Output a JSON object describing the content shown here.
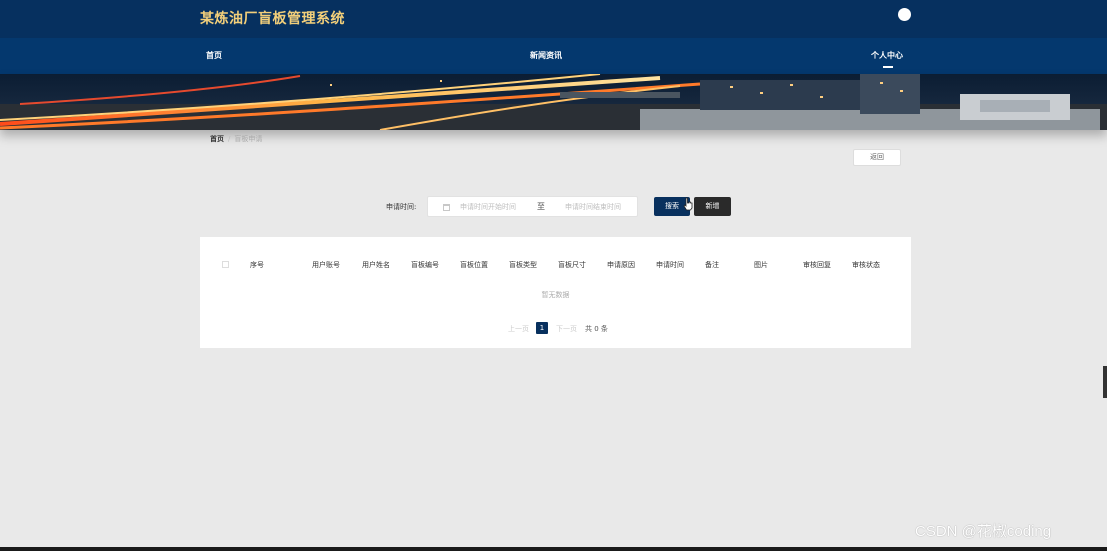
{
  "header": {
    "site_title": "某炼油厂盲板管理系统"
  },
  "nav": {
    "items": [
      "首页",
      "新闻资讯",
      "个人中心"
    ],
    "active": "个人中心"
  },
  "breadcrumb": {
    "home": "首页",
    "separator": "/",
    "current": "盲板申请"
  },
  "actions": {
    "back_label": "返回"
  },
  "filter": {
    "label": "申请时间:",
    "start_placeholder": "申请时间开始时间",
    "range_separator": "至",
    "end_placeholder": "申请时间结束时间",
    "search_label": "搜索",
    "add_label": "新增"
  },
  "table": {
    "columns": [
      "序号",
      "用户账号",
      "用户姓名",
      "盲板编号",
      "盲板位置",
      "盲板类型",
      "盲板尺寸",
      "申请原因",
      "申请时间",
      "备注",
      "图片",
      "审核回复",
      "审核状态"
    ],
    "empty_text": "暂无数据"
  },
  "pagination": {
    "prev_label": "上一页",
    "current_page": "1",
    "next_label": "下一页",
    "total_text": "共 0 条"
  },
  "watermark": "CSDN @花椒coding",
  "colors": {
    "header_bg": "#06305f",
    "nav_bg": "#04386e",
    "title_gold": "#f2cf7a",
    "primary": "#08305e",
    "page_bg": "#e9e9e9"
  }
}
